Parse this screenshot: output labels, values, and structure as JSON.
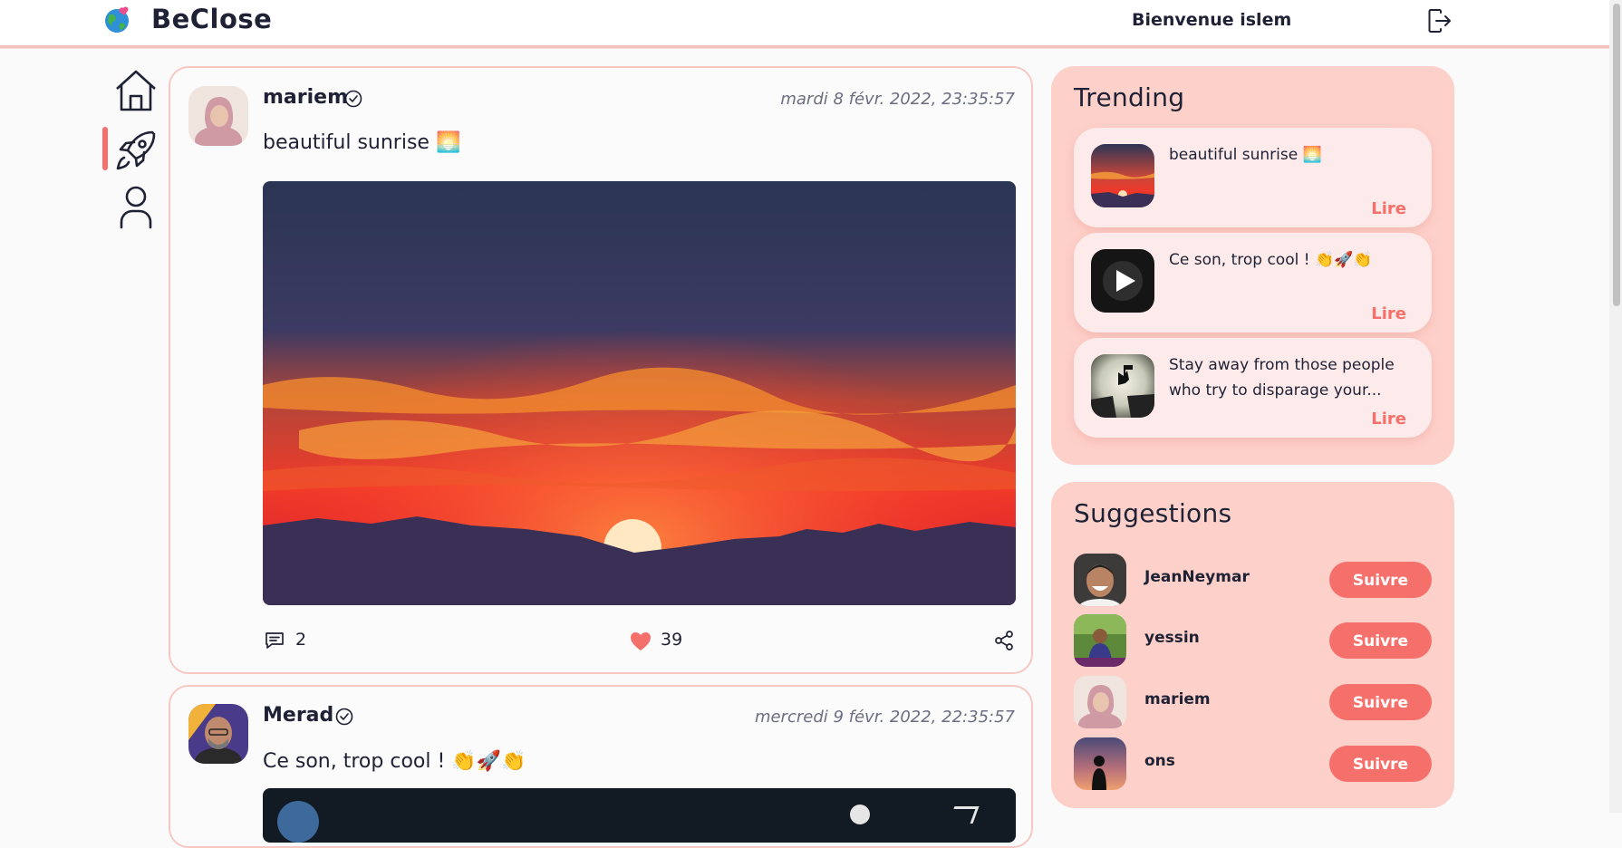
{
  "header": {
    "brand": "BeClose",
    "welcome": "Bienvenue islem",
    "logout_icon": "logout-icon"
  },
  "nav": {
    "items": [
      {
        "icon": "home-icon",
        "active": false
      },
      {
        "icon": "rocket-icon",
        "active": true
      },
      {
        "icon": "user-icon",
        "active": false
      }
    ]
  },
  "posts": [
    {
      "author": "mariem",
      "date": "mardi 8 févr. 2022, 23:35:57",
      "text": "beautiful sunrise 🌅",
      "comments": "2",
      "likes": "39"
    },
    {
      "author": "Merad",
      "date": "mercredi 9 févr. 2022, 22:35:57",
      "text": "Ce son, trop cool ! 👏🚀👏"
    }
  ],
  "trending": {
    "title": "Trending",
    "items": [
      {
        "text": "beautiful sunrise 🌅",
        "action": "Lire"
      },
      {
        "text": "Ce son, trop cool ! 👏🚀👏",
        "action": "Lire"
      },
      {
        "text": "Stay away from those people who try to disparage your...",
        "action": "Lire"
      }
    ]
  },
  "suggestions": {
    "title": "Suggestions",
    "items": [
      {
        "name": "JeanNeymar",
        "button": "Suivre"
      },
      {
        "name": "yessin",
        "button": "Suivre"
      },
      {
        "name": "mariem",
        "button": "Suivre"
      },
      {
        "name": "ons",
        "button": "Suivre"
      }
    ]
  },
  "colors": {
    "accent": "#f6706b",
    "panel": "#fdd0c9",
    "card": "#fdeaea",
    "text": "#1f2235"
  }
}
